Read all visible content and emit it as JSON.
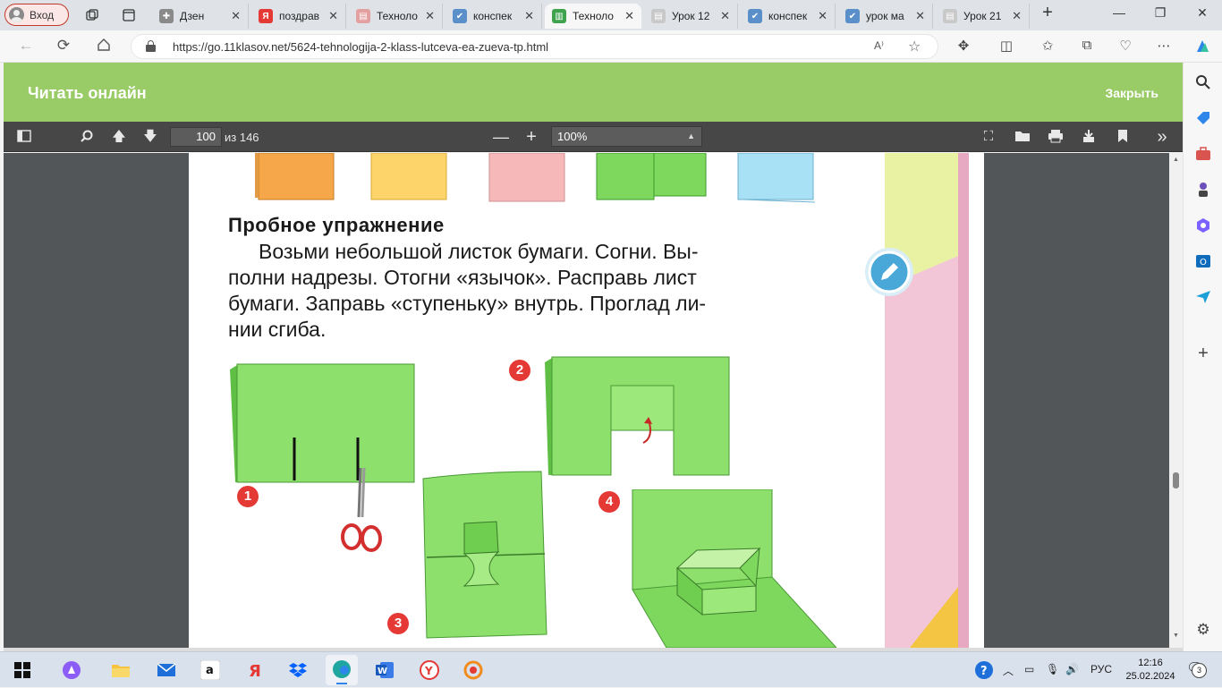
{
  "browser": {
    "profile_label": "Вход",
    "tabs": [
      {
        "title": "Дзен",
        "favicon_color": "#8a8a8a",
        "favicon_glyph": "✚"
      },
      {
        "title": "поздрав",
        "favicon_color": "#e53935",
        "favicon_glyph": "Я"
      },
      {
        "title": "Техноло",
        "favicon_color": "#e4a0a0",
        "favicon_glyph": "▤"
      },
      {
        "title": "конспек",
        "favicon_color": "#5a8fc9",
        "favicon_glyph": "✔"
      },
      {
        "title": "Техноло",
        "favicon_color": "#3fa34d",
        "favicon_glyph": "▥",
        "active": true
      },
      {
        "title": "Урок 12",
        "favicon_color": "#c9c9c9",
        "favicon_glyph": "▤"
      },
      {
        "title": "конспек",
        "favicon_color": "#5a8fc9",
        "favicon_glyph": "✔"
      },
      {
        "title": "урок ма",
        "favicon_color": "#5a8fc9",
        "favicon_glyph": "✔"
      },
      {
        "title": "Урок 21",
        "favicon_color": "#c9c9c9",
        "favicon_glyph": "▤"
      }
    ],
    "url": "https://go.11klasov.net/5624-tehnologija-2-klass-lutceva-ea-zueva-tp.html"
  },
  "reader": {
    "title": "Читать онлайн",
    "close_label": "Закрыть"
  },
  "pdf_toolbar": {
    "page_number": "100",
    "page_total": "из 146",
    "zoom": "100%"
  },
  "page": {
    "heading": "Пробное упражнение",
    "lines": [
      "Возьми небольшой листок бумаги. Согни. Вы-",
      "полни надрезы. Отогни «язычок». Расправь лист",
      "бумаги. Заправь «ступеньку» внутрь. Проглад ли-",
      "нии сгиба."
    ],
    "steps": [
      "1",
      "2",
      "3",
      "4"
    ]
  },
  "taskbar": {
    "language": "РУС",
    "time": "12:16",
    "date": "25.02.2024",
    "notifications": "3"
  },
  "colors": {
    "reader_green": "#99cc66",
    "pdf_toolbar": "#474747",
    "viewer_bg": "#525659",
    "paper_green": "#7fd85e",
    "step_red": "#e53935"
  }
}
